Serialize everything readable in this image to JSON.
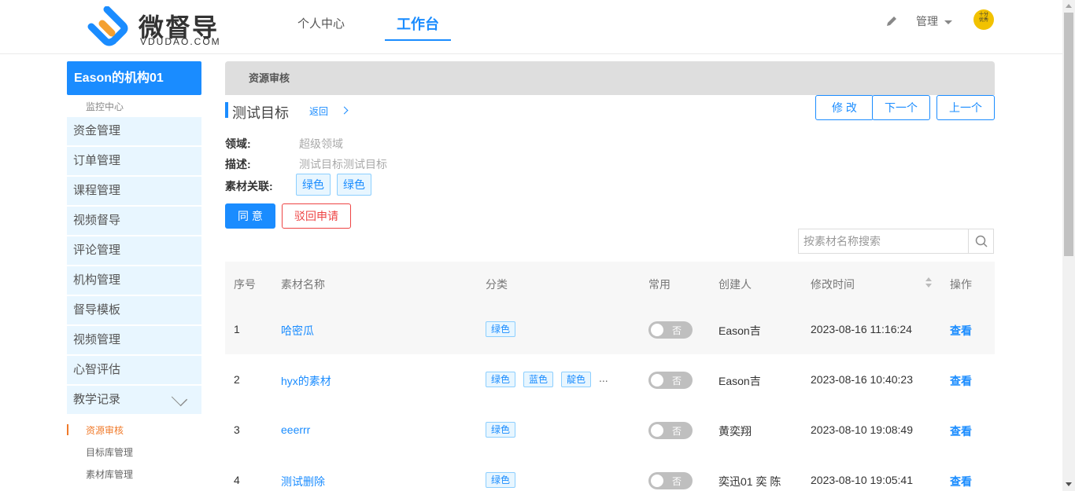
{
  "header": {
    "brand": "微督导",
    "brand_sub": "VDUDAO.COM",
    "nav": [
      "个人中心",
      "工作台"
    ],
    "user_menu": "管理",
    "avatar_text": [
      "十分",
      "优秀"
    ]
  },
  "sidebar": {
    "org": "Eason的机构01",
    "monitor": "监控中心",
    "items": [
      "资金管理",
      "订单管理",
      "课程管理",
      "视频督导",
      "评论管理",
      "机构管理",
      "督导模板",
      "视频管理",
      "心智评估",
      "教学记录"
    ],
    "sub_items": [
      "资源审核",
      "目标库管理",
      "素材库管理"
    ]
  },
  "main": {
    "breadcrumb": "资源审核",
    "title": "测试目标",
    "back": "返回",
    "actions": [
      "修 改",
      "下一个",
      "上一个"
    ],
    "fields": {
      "domain_label": "领域:",
      "domain_value": "超级领域",
      "desc_label": "描述:",
      "desc_value": "测试目标测试目标",
      "material_label": "素材关联:",
      "material_tags": [
        "绿色",
        "绿色"
      ]
    },
    "agree": "同 意",
    "reject": "驳回申请",
    "search_placeholder": "按素材名称搜索"
  },
  "table": {
    "headers": [
      "序号",
      "素材名称",
      "分类",
      "常用",
      "创建人",
      "修改时间",
      "操作"
    ],
    "rows": [
      {
        "no": "1",
        "name": "哈密瓜",
        "tags": [
          "绿色"
        ],
        "more": "",
        "common": "否",
        "creator": "Eason吉",
        "time": "2023-08-16 11:16:24",
        "op": "查看"
      },
      {
        "no": "2",
        "name": "hyx的素材",
        "tags": [
          "绿色",
          "蓝色",
          "靛色"
        ],
        "more": "...",
        "common": "否",
        "creator": "Eason吉",
        "time": "2023-08-16 10:40:23",
        "op": "查看"
      },
      {
        "no": "3",
        "name": "eeerrr",
        "tags": [
          "绿色"
        ],
        "more": "",
        "common": "否",
        "creator": "黄奕翔",
        "time": "2023-08-10 19:08:49",
        "op": "查看"
      },
      {
        "no": "4",
        "name": "测试删除",
        "tags": [
          "绿色"
        ],
        "more": "",
        "common": "否",
        "creator": "奕迅01 奕 陈",
        "time": "2023-08-10 19:05:41",
        "op": "查看"
      }
    ]
  },
  "colors": {
    "accent": "#1a8cff",
    "sidebar_bg": "#e8f6ff",
    "danger": "#ee4444",
    "active_sub": "#f07a2a"
  }
}
